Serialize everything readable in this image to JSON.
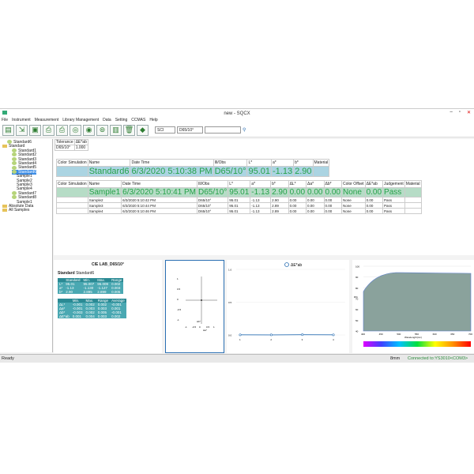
{
  "title": "new - SQCX",
  "menu": [
    "File",
    "Instrument",
    "Measurement",
    "Library Management",
    "Data",
    "Setting",
    "CCMAS",
    "Help"
  ],
  "toolbar": {
    "icons": [
      "new-icon",
      "import-icon",
      "save-icon",
      "print-icon",
      "print-result-icon",
      "target-icon",
      "target2-icon",
      "target3-icon",
      "chart-icon",
      "delete-icon",
      "color-icon"
    ],
    "sci": "SCI",
    "illuminant": "D65/10°",
    "search_placeholder": ""
  },
  "tree": [
    {
      "label": "Standard6",
      "indent": 1,
      "icon": "std"
    },
    {
      "label": "Standard",
      "indent": 0,
      "icon": "folder"
    },
    {
      "label": "Standard1",
      "indent": 2,
      "icon": "std"
    },
    {
      "label": "Standard2",
      "indent": 2,
      "icon": "std"
    },
    {
      "label": "Standard3",
      "indent": 2,
      "icon": "std"
    },
    {
      "label": "Standard4",
      "indent": 2,
      "icon": "std"
    },
    {
      "label": "Standard5",
      "indent": 2,
      "icon": "std"
    },
    {
      "label": "Standard6",
      "indent": 2,
      "icon": "std",
      "selected": true
    },
    {
      "label": "Sample1",
      "indent": 3,
      "icon": "none"
    },
    {
      "label": "Sample2",
      "indent": 3,
      "icon": "none"
    },
    {
      "label": "Sample3",
      "indent": 3,
      "icon": "none"
    },
    {
      "label": "Sample4",
      "indent": 3,
      "icon": "none"
    },
    {
      "label": "Standard7",
      "indent": 2,
      "icon": "std"
    },
    {
      "label": "Standard8",
      "indent": 2,
      "icon": "std"
    },
    {
      "label": "Sample1",
      "indent": 3,
      "icon": "none"
    },
    {
      "label": "Absolute Data",
      "indent": 0,
      "icon": "folder"
    },
    {
      "label": "All Samples",
      "indent": 0,
      "icon": "folder"
    }
  ],
  "tolerance": {
    "h1": "Tolerance",
    "h2": "ΔE*ab",
    "v1": "D65/10°",
    "v2": "1.000"
  },
  "std_table": {
    "headers": [
      "Color Simulation",
      "Name",
      "Date Time",
      "Ill/Obs",
      "L*",
      "a*",
      "b*",
      "Material"
    ],
    "row": [
      "",
      "Standard6",
      "6/3/2020 5:10:38 PM",
      "D65/10°",
      "95.01",
      "-1.13",
      "2.90",
      ""
    ]
  },
  "smp_table": {
    "headers": [
      "Color Simulation",
      "Name",
      "Date Time",
      "Ill/Obs",
      "L*",
      "a*",
      "b*",
      "ΔL*",
      "Δa*",
      "Δb*",
      "Color Offset",
      "ΔE*ab",
      "Judgement",
      "Material"
    ],
    "rows": [
      [
        "",
        "Sample1",
        "6/3/2020 5:10:41 PM",
        "D65/10°",
        "95.01",
        "-1.13",
        "2.90",
        "0.00",
        "0.00",
        "0.00",
        "None",
        "0.00",
        "Pass",
        ""
      ],
      [
        "",
        "Sample2",
        "6/3/2020 5:10:42 PM",
        "D65/10°",
        "95.01",
        "-1.13",
        "2.90",
        "0.00",
        "0.00",
        "0.00",
        "None",
        "0.00",
        "Pass",
        ""
      ],
      [
        "",
        "Sample3",
        "6/3/2020 5:10:44 PM",
        "D65/10°",
        "95.01",
        "-1.13",
        "2.89",
        "0.00",
        "0.00",
        "0.00",
        "None",
        "0.00",
        "Pass",
        ""
      ],
      [
        "",
        "Sample4",
        "6/3/2020 5:10:46 PM",
        "D65/10°",
        "95.01",
        "-1.13",
        "2.89",
        "0.00",
        "0.00",
        "0.00",
        "None",
        "0.00",
        "Pass",
        ""
      ]
    ]
  },
  "stats": {
    "title": "CIE LAB_D65/10°",
    "std_label": "Standard",
    "std_name": "Standard6",
    "h1": [
      "",
      "Standard",
      "Min.",
      "Max.",
      "Range"
    ],
    "r1": [
      [
        "L*",
        "95.01",
        "95.007",
        "95.009",
        "0.002"
      ],
      [
        "a*",
        "-1.13",
        "-1.130",
        "-1.127",
        "0.003"
      ],
      [
        "b*",
        "2.90",
        "2.895",
        "2.899",
        "0.005"
      ]
    ],
    "h2": [
      "",
      "Min.",
      "Max.",
      "Range",
      "Average"
    ],
    "r2": [
      [
        "ΔL*",
        "-0.001",
        "0.002",
        "0.002",
        "-0.001"
      ],
      [
        "Δa*",
        "-0.001",
        "0.003",
        "0.003",
        "0.001"
      ],
      [
        "Δb*",
        "-0.003",
        "0.002",
        "0.005",
        "-0.001"
      ],
      [
        "ΔE*ab",
        "0.001",
        "0.004",
        "0.003",
        "0.002"
      ]
    ]
  },
  "plotA": {
    "yticks": [
      "1",
      "0.5",
      "0",
      "-0.5",
      "-1"
    ],
    "xticks": [
      "-1",
      "-0.5",
      "0",
      "0.5",
      "1"
    ],
    "xlabel": "Δa*",
    "ylabel": "Δb*"
  },
  "plotB": {
    "legend": "ΔE*ab",
    "yticks": [
      "1.0",
      "0.5",
      "0.0"
    ],
    "xticks": [
      "1",
      "2",
      "3",
      "4"
    ],
    "values": [
      0.002,
      0.001,
      0.004,
      0.002
    ]
  },
  "plotC": {
    "ylabel": "R%",
    "xlabel": "Wavelength(nm)",
    "yticks": [
      "100",
      "90",
      "80",
      "70",
      "60",
      "50",
      "40"
    ],
    "xticks": [
      "400",
      "450",
      "500",
      "550",
      "600",
      "650",
      "700"
    ]
  },
  "status": {
    "left": "Ready",
    "aperture": "8mm",
    "conn": "Connected to:YS3010<COM3>"
  },
  "colors": {
    "accent": "#27a24a",
    "select": "#3c8de6",
    "teal": "#2b8a94"
  }
}
